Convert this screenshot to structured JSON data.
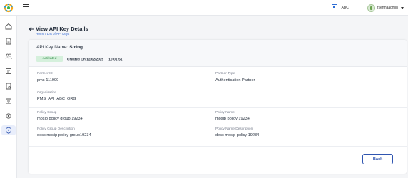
{
  "topbar": {
    "org_label": "ABC",
    "username": "rserthaadmin"
  },
  "header": {
    "title": "View API Key Details",
    "breadcrumb": "Home / List of API Keys"
  },
  "api_key": {
    "name_label": "API Key Name:",
    "name_value": "String",
    "status": "Activated",
    "created_label": "Created On 12/02/2025",
    "created_time": "10:01:51"
  },
  "details": {
    "partner_id_label": "Partner ID",
    "partner_id_value": "pms-111999",
    "partner_type_label": "Partner Type",
    "partner_type_value": "Authentication Partner",
    "organisation_label": "Organisation",
    "organisation_value": "PMS_API_ABC_ORG",
    "policy_group_label": "Policy Group",
    "policy_group_value": "mosip policy group 19234",
    "policy_name_label": "Policy Name",
    "policy_name_value": "mosip policy 19234",
    "policy_group_desc_label": "Policy Group Description",
    "policy_group_desc_value": "desc mosip policy group19234",
    "policy_name_desc_label": "Policy Name Description",
    "policy_name_desc_value": "desc mosip policy 19234"
  },
  "actions": {
    "back_label": "Back"
  },
  "colors": {
    "accent": "#2f55b0",
    "status_bg": "#d5f0dc",
    "status_text": "#2f8a47"
  },
  "icons": {
    "logo": "mosip-logo-icon",
    "menu": "hamburger-menu-icon",
    "org": "organisation-icon",
    "back": "back-arrow-icon"
  }
}
